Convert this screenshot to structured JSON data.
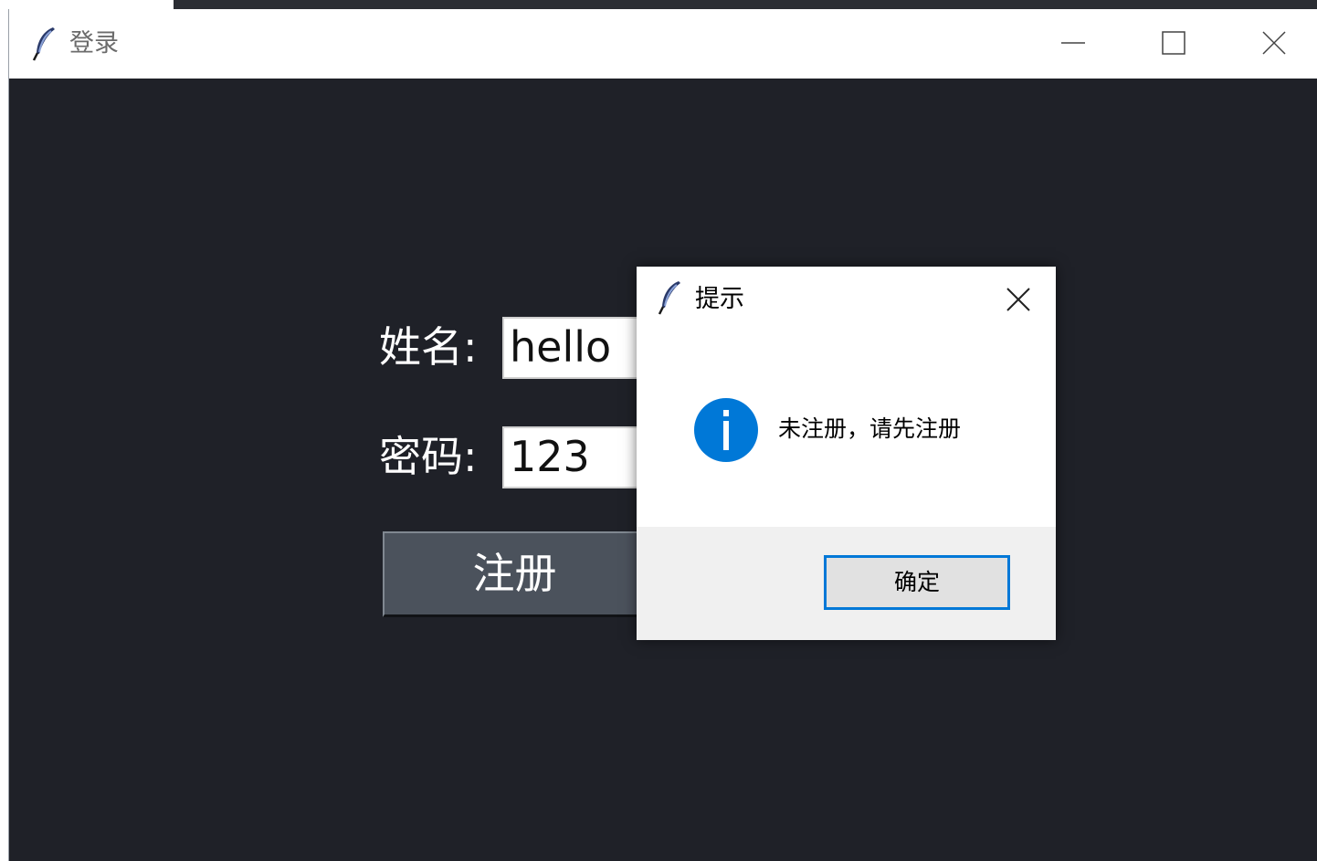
{
  "window": {
    "title": "登录",
    "controls": {
      "minimize": "minimize-icon",
      "maximize": "maximize-icon",
      "close": "close-icon"
    }
  },
  "form": {
    "name_label": "姓名:",
    "name_value": "hello",
    "password_label": "密码:",
    "password_value": "123",
    "register_label": "注册"
  },
  "dialog": {
    "title": "提示",
    "message": "未注册，请先注册",
    "ok_label": "确定",
    "icon": "info-icon"
  },
  "colors": {
    "window_bg": "#1f2128",
    "button_bg": "#4b525c",
    "dialog_accent": "#0078d7",
    "info_icon": "#0078d7"
  }
}
